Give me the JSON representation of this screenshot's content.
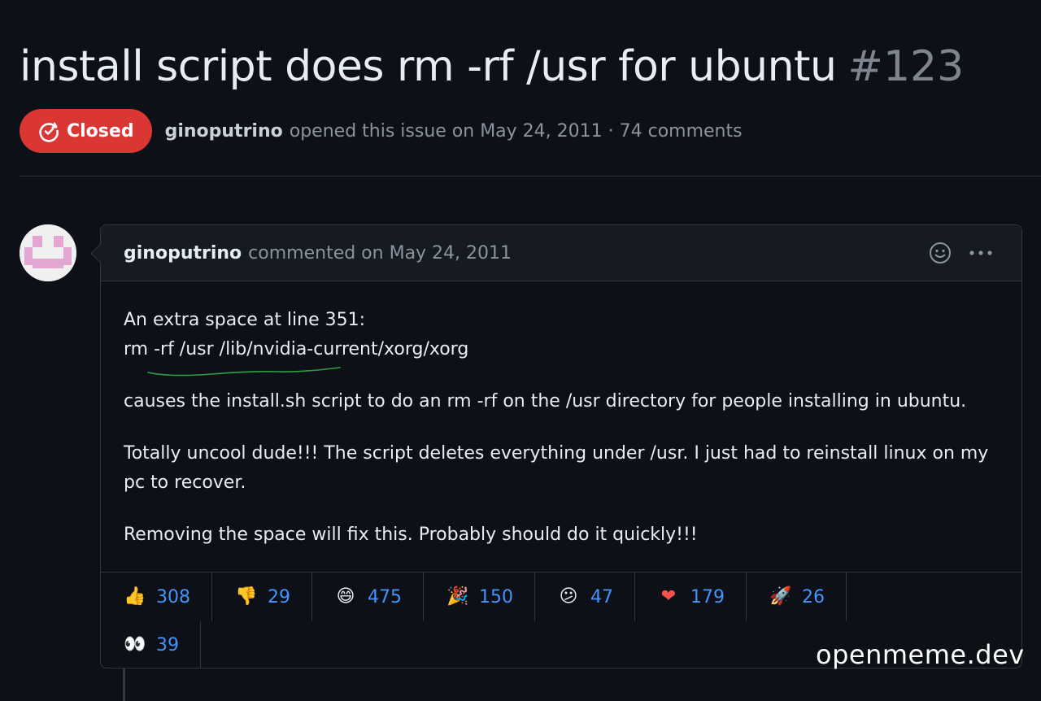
{
  "issue": {
    "title": "install script does rm -rf /usr for ubuntu",
    "number": "#123",
    "state": "Closed",
    "state_color": "#da3633",
    "author": "ginoputrino",
    "opened_text": "opened this issue on May 24, 2011 · 74 comments"
  },
  "comment": {
    "author": "ginoputrino",
    "timestamp_text": "commented on May 24, 2011",
    "actions": {
      "emoji_icon": "smiley-icon",
      "more_icon": "kebab-horizontal-icon"
    },
    "body": {
      "line1": "An extra space at line 351:",
      "code": "rm -rf /usr /lib/nvidia-current/xorg/xorg",
      "p2": "causes the install.sh script to do an rm -rf on the /usr directory for people installing in ubuntu.",
      "p3": "Totally uncool dude!!! The script deletes everything under /usr. I just had to reinstall linux on my pc to recover.",
      "p4": "Removing the space will fix this. Probably should do it quickly!!!"
    }
  },
  "reactions": [
    {
      "name": "thumbs-up",
      "emoji": "👍",
      "count": "308"
    },
    {
      "name": "thumbs-down",
      "emoji": "👎",
      "count": "29"
    },
    {
      "name": "laugh",
      "emoji": "😄",
      "count": "475"
    },
    {
      "name": "hooray",
      "emoji": "🎉",
      "count": "150"
    },
    {
      "name": "confused",
      "emoji": "😕",
      "count": "47"
    },
    {
      "name": "heart",
      "emoji": "❤",
      "count": "179"
    },
    {
      "name": "rocket",
      "emoji": "🚀",
      "count": "26"
    },
    {
      "name": "eyes",
      "emoji": "👀",
      "count": "39"
    }
  ],
  "watermark": "openmeme.dev",
  "colors": {
    "background": "#0d1117",
    "accent_link": "#4493f8",
    "annotation_green": "#2ea043"
  }
}
